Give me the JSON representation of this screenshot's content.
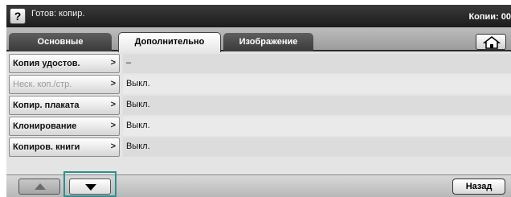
{
  "status": {
    "help_label": "?",
    "message": "Готов: копир.",
    "copies": "Копии: 00"
  },
  "tabs": [
    {
      "label": "Основные",
      "active": false
    },
    {
      "label": "Дополнительно",
      "active": true
    },
    {
      "label": "Изображение",
      "active": false
    }
  ],
  "home_icon": "home-icon",
  "rows": [
    {
      "label": "Копия удостов.",
      "value": "–",
      "enabled": true
    },
    {
      "label": "Неск. коп./стр.",
      "value": "Выкл.",
      "enabled": false
    },
    {
      "label": "Копир. плаката",
      "value": "Выкл.",
      "enabled": true
    },
    {
      "label": "Клонирование",
      "value": "Выкл.",
      "enabled": true
    },
    {
      "label": "Копиров. книги",
      "value": "Выкл.",
      "enabled": true
    }
  ],
  "chevron": ">",
  "bottom": {
    "back_label": "Назад",
    "up_enabled": false,
    "down_enabled": true
  },
  "colors": {
    "focus": "#2f8f8f",
    "disabled_text": "#9a9a9a"
  }
}
